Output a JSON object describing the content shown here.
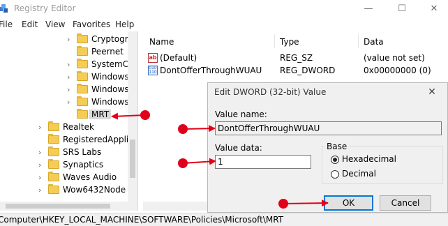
{
  "window": {
    "title": "Registry Editor",
    "minimize": "—",
    "maximize": "☐",
    "close": "✕"
  },
  "menu": [
    "File",
    "Edit",
    "View",
    "Favorites",
    "Help"
  ],
  "tree": [
    {
      "label": "Cryptogra",
      "indent": 2,
      "expand": true
    },
    {
      "label": "Peernet",
      "indent": 2,
      "expand": false
    },
    {
      "label": "SystemCe",
      "indent": 2,
      "expand": true
    },
    {
      "label": "Windows",
      "indent": 2,
      "expand": true
    },
    {
      "label": "Windows",
      "indent": 2,
      "expand": true
    },
    {
      "label": "Windows",
      "indent": 2,
      "expand": true
    },
    {
      "label": "MRT",
      "indent": 2,
      "expand": false,
      "selected": true
    },
    {
      "label": "Realtek",
      "indent": 1,
      "expand": true
    },
    {
      "label": "RegisteredApplic",
      "indent": 1,
      "expand": false
    },
    {
      "label": "SRS Labs",
      "indent": 1,
      "expand": true
    },
    {
      "label": "Synaptics",
      "indent": 1,
      "expand": true
    },
    {
      "label": "Waves Audio",
      "indent": 1,
      "expand": true
    },
    {
      "label": "Wow6432Node",
      "indent": 1,
      "expand": true
    }
  ],
  "columns": {
    "name": "Name",
    "type": "Type",
    "data": "Data"
  },
  "values": [
    {
      "name": "(Default)",
      "type": "REG_SZ",
      "data": "(value not set)",
      "icon": "string-value-icon"
    },
    {
      "name": "DontOfferThroughWUAU",
      "type": "REG_DWORD",
      "data": "0x00000000 (0)",
      "icon": "dword-value-icon"
    }
  ],
  "status": {
    "path": "Computer\\HKEY_LOCAL_MACHINE\\SOFTWARE\\Policies\\Microsoft\\MRT"
  },
  "dialog": {
    "title": "Edit DWORD (32-bit) Value",
    "close": "✕",
    "value_name_label": "Value name:",
    "value_name": "DontOfferThroughWUAU",
    "value_data_label": "Value data:",
    "value_data": "1",
    "base_label": "Base",
    "base_options": [
      {
        "label": "Hexadecimal",
        "checked": true
      },
      {
        "label": "Decimal",
        "checked": false
      }
    ],
    "ok_label": "OK",
    "cancel_label": "Cancel"
  },
  "colors": {
    "annotation_red": "#e0001a",
    "dialog_focus": "#0078d7",
    "folder": "#f5cd55"
  }
}
